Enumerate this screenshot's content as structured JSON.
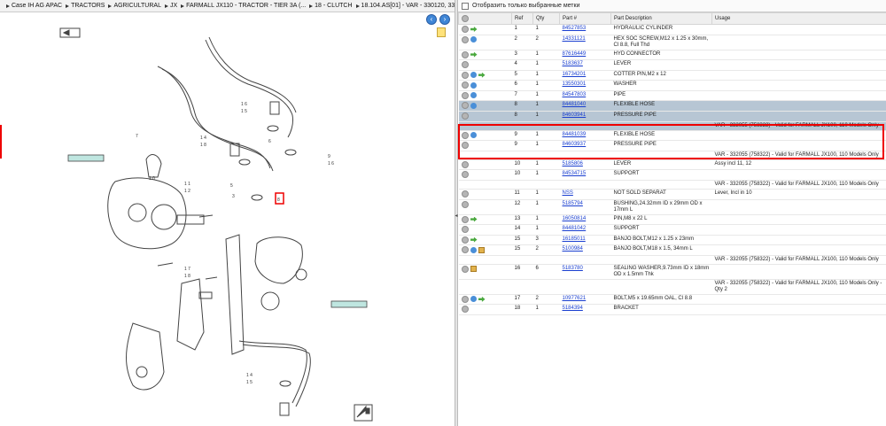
{
  "breadcrumb": {
    "items": [
      "Case IH AG APAC",
      "TRACTORS",
      "AGRICULTURAL",
      "JX",
      "FARMALL JX110 - TRACTOR - TIER 3A (...",
      "18 - CLUTCH",
      "18.104.AS[01] - VAR - 330120, 331120, 743..."
    ]
  },
  "filter": {
    "label": "Отобразить только выбранные метки"
  },
  "columns": {
    "ref": "Ref",
    "qty": "Qty",
    "part": "Part #",
    "desc": "Part Description",
    "usage": "Usage"
  },
  "diagram": {
    "labels": [
      "1 6",
      "1 5",
      "1 4",
      "1 8",
      "9",
      "1 6",
      "7",
      "6",
      "5",
      "3",
      "1 0",
      "1 1",
      "1 2",
      "1 7",
      "1 8",
      "1 4",
      "1 5"
    ],
    "callout_note": "8"
  },
  "parts": [
    {
      "ref": "1",
      "qty": "1",
      "part": "84527853",
      "desc": "HYDRAULIC CYLINDER",
      "usage": "",
      "icons": "gray,green"
    },
    {
      "ref": "2",
      "qty": "2",
      "part": "14331121",
      "desc": "HEX SOC SCREW,M12 x 1.25 x 30mm, Cl 8.8, Full Thd",
      "usage": "",
      "icons": "gray,blue"
    },
    {
      "ref": "3",
      "qty": "1",
      "part": "87616449",
      "desc": "HYD CONNECTOR",
      "usage": "",
      "icons": "gray,green"
    },
    {
      "ref": "4",
      "qty": "1",
      "part": "5183637",
      "desc": "LEVER",
      "usage": "",
      "icons": "gray"
    },
    {
      "ref": "5",
      "qty": "1",
      "part": "16734201",
      "desc": "COTTER PIN,M2 x 12",
      "usage": "",
      "icons": "gray,blue,green"
    },
    {
      "ref": "6",
      "qty": "1",
      "part": "13550301",
      "desc": "WASHER",
      "usage": "",
      "icons": "gray,blue"
    },
    {
      "ref": "7",
      "qty": "1",
      "part": "84547803",
      "desc": "PIPE",
      "usage": "",
      "icons": "gray,blue"
    },
    {
      "ref": "8",
      "qty": "1",
      "part": "84481040",
      "desc": "FLEXIBLE HOSE",
      "usage": "",
      "icons": "gray,blue",
      "selected": true
    },
    {
      "ref": "8",
      "qty": "1",
      "part": "84603941",
      "desc": "PRESSURE PIPE",
      "usage": "",
      "icons": "gray",
      "selected": true
    },
    {
      "ref": "",
      "qty": "",
      "part": "",
      "desc": "",
      "usage": "VAR - 332055 (758322) - Valid for FARMALL JX100, 110 Models Only",
      "icons": "",
      "selected": true,
      "note": true
    },
    {
      "ref": "9",
      "qty": "1",
      "part": "84481039",
      "desc": "FLEXIBLE HOSE",
      "usage": "",
      "icons": "gray,blue"
    },
    {
      "ref": "9",
      "qty": "1",
      "part": "84603937",
      "desc": "PRESSURE PIPE",
      "usage": "",
      "icons": "gray"
    },
    {
      "ref": "",
      "qty": "",
      "part": "",
      "desc": "",
      "usage": "VAR - 332055 (758322) - Valid for FARMALL JX100, 110 Models Only",
      "icons": "",
      "note": true
    },
    {
      "ref": "10",
      "qty": "1",
      "part": "5185806",
      "desc": "LEVER",
      "usage": "Assy incl 11, 12",
      "icons": "gray"
    },
    {
      "ref": "10",
      "qty": "1",
      "part": "84534715",
      "desc": "SUPPORT",
      "usage": "",
      "icons": "gray"
    },
    {
      "ref": "",
      "qty": "",
      "part": "",
      "desc": "",
      "usage": "VAR - 332055 (758322) - Valid for FARMALL JX100, 110 Models Only",
      "icons": "",
      "note": true
    },
    {
      "ref": "11",
      "qty": "1",
      "part": "NSS",
      "desc": "NOT SOLD SEPARAT",
      "usage": "Lever, Incl in 10",
      "icons": "gray"
    },
    {
      "ref": "12",
      "qty": "1",
      "part": "5185794",
      "desc": "BUSHING,24.32mm ID x 29mm OD x 17mm L",
      "usage": "",
      "icons": "gray"
    },
    {
      "ref": "13",
      "qty": "1",
      "part": "16050814",
      "desc": "PIN,M8 x 22 L",
      "usage": "",
      "icons": "gray,green"
    },
    {
      "ref": "14",
      "qty": "1",
      "part": "84481042",
      "desc": "SUPPORT",
      "usage": "",
      "icons": "gray"
    },
    {
      "ref": "15",
      "qty": "3",
      "part": "16185011",
      "desc": "BANJO BOLT,M12 x 1.25 x 23mm",
      "usage": "",
      "icons": "gray,green"
    },
    {
      "ref": "15",
      "qty": "2",
      "part": "5100984",
      "desc": "BANJO BOLT,M18 x 1.5, 34mm L",
      "usage": "",
      "icons": "gray,blue,box"
    },
    {
      "ref": "",
      "qty": "",
      "part": "",
      "desc": "",
      "usage": "VAR - 332055 (758322) - Valid for FARMALL JX100, 110 Models Only",
      "icons": "",
      "note": true
    },
    {
      "ref": "16",
      "qty": "6",
      "part": "5183780",
      "desc": "SEALING WASHER,9.73mm ID x 18mm OD x 1.5mm Thk",
      "usage": "",
      "icons": "gray,box"
    },
    {
      "ref": "",
      "qty": "",
      "part": "",
      "desc": "",
      "usage": "VAR - 332055 (758322) - Valid for FARMALL JX100, 110 Models Only - Qty 2",
      "icons": "",
      "note": true
    },
    {
      "ref": "17",
      "qty": "2",
      "part": "10977621",
      "desc": "BOLT,M5 x 19.65mm OAL, Cl 8.8",
      "usage": "",
      "icons": "gray,blue,green"
    },
    {
      "ref": "18",
      "qty": "1",
      "part": "5184394",
      "desc": "BRACKET",
      "usage": "",
      "icons": "gray"
    }
  ]
}
